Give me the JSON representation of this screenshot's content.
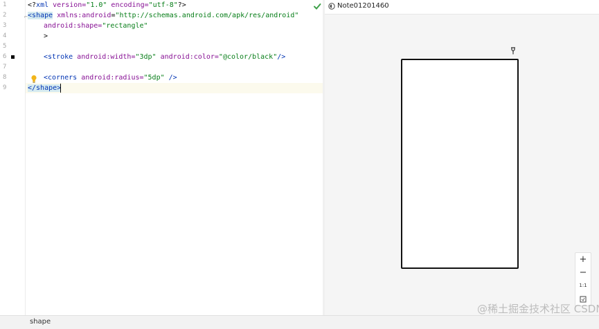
{
  "editor": {
    "line_numbers": [
      "1",
      "2",
      "3",
      "4",
      "5",
      "6",
      "7",
      "8",
      "9"
    ],
    "lines": {
      "l1": {
        "a": "<?",
        "b": "xml",
        "c": " version=",
        "d": "\"1.0\"",
        "e": " encoding=",
        "f": "\"utf-8\"",
        "g": "?>"
      },
      "l2": {
        "a": "<shape",
        "b": " xmlns:",
        "c": "android",
        "d": "=",
        "e": "\"http://schemas.android.com/apk/res/android\""
      },
      "l3": {
        "a": "android",
        "b": ":shape=",
        "c": "\"rectangle\""
      },
      "l4": {
        "a": ">"
      },
      "l6": {
        "a": "<stroke",
        "b": " android",
        "c": ":width=",
        "d": "\"3dp\"",
        "e": " android",
        "f": ":color=",
        "g": "\"@color/black\"",
        "h": "/>"
      },
      "l8": {
        "a": "<corners",
        "b": " android",
        "c": ":radius=",
        "d": "\"5dp\"",
        "e": " />"
      },
      "l9": {
        "a": "</shape>"
      }
    }
  },
  "preview": {
    "device_name": "Note01201460",
    "zoom": {
      "in": "+",
      "out": "−",
      "actual": "1:1"
    }
  },
  "watermark": "@稀土掘金技术社区 CSDN @傲笑狗",
  "status": {
    "breadcrumb": "shape"
  },
  "colors": {
    "tag": "#0033b3",
    "attribute": "#871094",
    "value": "#067d17",
    "stroke": "#111111"
  }
}
